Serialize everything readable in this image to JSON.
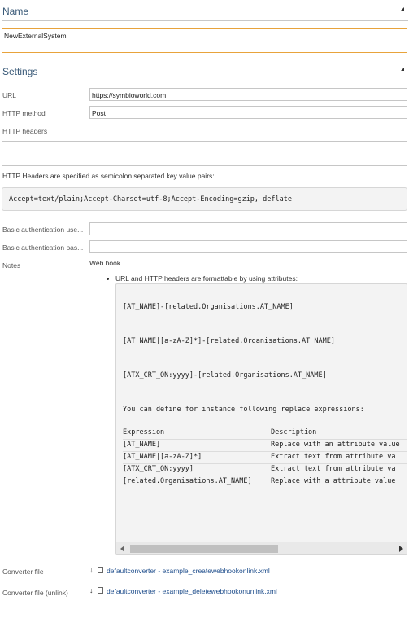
{
  "name_section": {
    "title": "Name",
    "value": "NewExternalSystem"
  },
  "settings_section": {
    "title": "Settings",
    "url_label": "URL",
    "url_value": "https://symbioworld.com",
    "method_label": "HTTP method",
    "method_value": "Post",
    "headers_label": "HTTP headers",
    "headers_value": "",
    "headers_hint": "HTTP Headers are specified as semicolon separated key value pairs:",
    "headers_example": "Accept=text/plain;Accept-Charset=utf-8;Accept-Encoding=gzip, deflate",
    "basic_user_label": "Basic authentication use...",
    "basic_user_value": "",
    "basic_pass_label": "Basic authentication pas...",
    "basic_pass_value": "",
    "notes_label": "Notes",
    "notes_heading": "Web hook",
    "notes_bullet": "URL and HTTP headers are formattable by using attributes:",
    "code_lines": [
      "[AT_NAME]-[related.Organisations.AT_NAME]",
      "[AT_NAME|[a-zA-Z]*]-[related.Organisations.AT_NAME]",
      "[ATX_CRT_ON:yyyy]-[related.Organisations.AT_NAME]",
      "You can define for instance following replace expressions:"
    ],
    "table_headers": [
      "Expression",
      "Description"
    ],
    "table_rows": [
      [
        "[AT_NAME]",
        "Replace with an attribute value"
      ],
      [
        "[AT_NAME|[a-zA-Z]*]",
        "Extract text from attribute va"
      ],
      [
        "[ATX_CRT_ON:yyyy]",
        "Extract text from attribute va"
      ],
      [
        "[related.Organisations.AT_NAME]",
        "Replace with a attribute value"
      ]
    ],
    "converter_label": "Converter file",
    "converter_link": "defaultconverter - example_createwebhookonlink.xml",
    "converter_unlink_label": "Converter file (unlink)",
    "converter_unlink_link": "defaultconverter - example_deletewebhookonunlink.xml"
  }
}
